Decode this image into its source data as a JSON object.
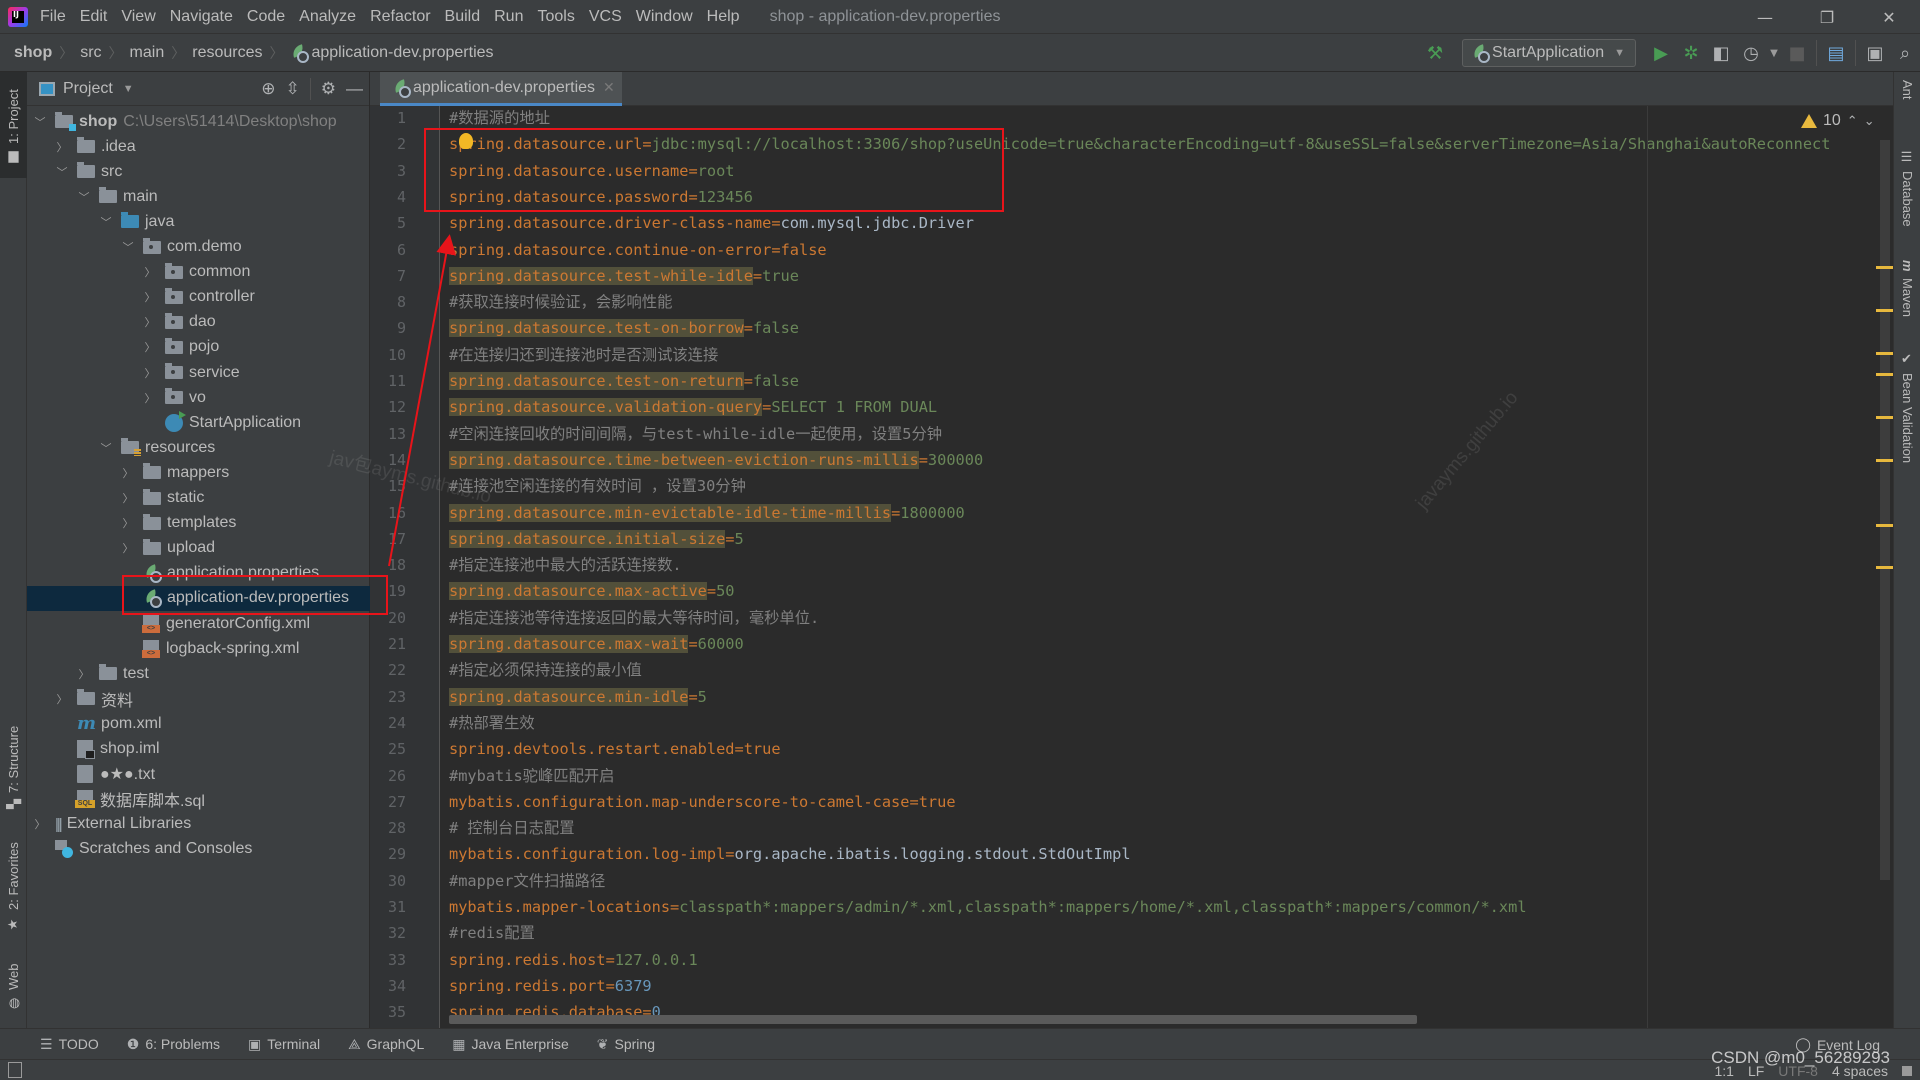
{
  "menubar": {
    "items": [
      "File",
      "Edit",
      "View",
      "Navigate",
      "Code",
      "Analyze",
      "Refactor",
      "Build",
      "Run",
      "Tools",
      "VCS",
      "Window",
      "Help"
    ],
    "window_title": "shop - application-dev.properties",
    "minimize": "—",
    "restore": "❐",
    "close": "✕"
  },
  "breadcrumb": [
    "shop",
    "src",
    "main",
    "resources",
    "application-dev.properties"
  ],
  "toolbar": {
    "run_config": "StartApplication"
  },
  "left_stripe": {
    "project": "1: Project",
    "structure": "7: Structure",
    "favorites": "2: Favorites",
    "web": "Web"
  },
  "right_stripe": [
    "Ant",
    "Database",
    "Maven",
    "Bean Validation"
  ],
  "project_panel": {
    "title": "Project",
    "tree": [
      {
        "label": "shop",
        "extra": "C:\\Users\\51414\\Desktop\\shop",
        "depth": 0,
        "arrow": "open",
        "icon": "module-folder"
      },
      {
        "label": ".idea",
        "depth": 1,
        "arrow": "closed",
        "icon": "folder"
      },
      {
        "label": "src",
        "depth": 1,
        "arrow": "open",
        "icon": "folder"
      },
      {
        "label": "main",
        "depth": 2,
        "arrow": "open",
        "icon": "folder"
      },
      {
        "label": "java",
        "depth": 3,
        "arrow": "open",
        "icon": "source-folder"
      },
      {
        "label": "com.demo",
        "depth": 4,
        "arrow": "open",
        "icon": "package"
      },
      {
        "label": "common",
        "depth": 5,
        "arrow": "closed",
        "icon": "package"
      },
      {
        "label": "controller",
        "depth": 5,
        "arrow": "closed",
        "icon": "package"
      },
      {
        "label": "dao",
        "depth": 5,
        "arrow": "closed",
        "icon": "package"
      },
      {
        "label": "pojo",
        "depth": 5,
        "arrow": "closed",
        "icon": "package"
      },
      {
        "label": "service",
        "depth": 5,
        "arrow": "closed",
        "icon": "package"
      },
      {
        "label": "vo",
        "depth": 5,
        "arrow": "closed",
        "icon": "package"
      },
      {
        "label": "StartApplication",
        "depth": 5,
        "arrow": "none",
        "icon": "spring-class"
      },
      {
        "label": "resources",
        "depth": 3,
        "arrow": "open",
        "icon": "resources-folder"
      },
      {
        "label": "mappers",
        "depth": 4,
        "arrow": "closed",
        "icon": "folder"
      },
      {
        "label": "static",
        "depth": 4,
        "arrow": "closed",
        "icon": "folder"
      },
      {
        "label": "templates",
        "depth": 4,
        "arrow": "closed",
        "icon": "folder"
      },
      {
        "label": "upload",
        "depth": 4,
        "arrow": "closed",
        "icon": "folder"
      },
      {
        "label": "application.properties",
        "depth": 4,
        "arrow": "none",
        "icon": "spring-properties"
      },
      {
        "label": "application-dev.properties",
        "depth": 4,
        "arrow": "none",
        "icon": "spring-properties",
        "selected": true
      },
      {
        "label": "generatorConfig.xml",
        "depth": 4,
        "arrow": "none",
        "icon": "xml"
      },
      {
        "label": "logback-spring.xml",
        "depth": 4,
        "arrow": "none",
        "icon": "xml"
      },
      {
        "label": "test",
        "depth": 2,
        "arrow": "closed",
        "icon": "folder"
      },
      {
        "label": "资料",
        "depth": 1,
        "arrow": "closed",
        "icon": "folder"
      },
      {
        "label": "pom.xml",
        "depth": 1,
        "arrow": "none",
        "icon": "maven"
      },
      {
        "label": "shop.iml",
        "depth": 1,
        "arrow": "none",
        "icon": "iml"
      },
      {
        "label": "●★●.txt",
        "depth": 1,
        "arrow": "none",
        "icon": "txt"
      },
      {
        "label": "数据库脚本.sql",
        "depth": 1,
        "arrow": "none",
        "icon": "sql"
      },
      {
        "label": "External Libraries",
        "depth": 0,
        "arrow": "closed",
        "icon": "libraries"
      },
      {
        "label": "Scratches and Consoles",
        "depth": 0,
        "arrow": "none",
        "icon": "scratches"
      }
    ]
  },
  "editor": {
    "tab_label": "application-dev.properties",
    "warnings_count": "10",
    "lines": [
      {
        "type": "comment",
        "text": "#数据源的地址"
      },
      {
        "type": "prop",
        "key": "spring.datasource.url",
        "value": "jdbc:mysql://localhost:3306/shop?useUnicode=true&characterEncoding=utf-8&useSSL=false&serverTimezone=Asia/Shanghai&autoReconnect",
        "vclass": "v"
      },
      {
        "type": "prop",
        "key": "spring.datasource.username",
        "value": "root",
        "vclass": "v"
      },
      {
        "type": "prop",
        "key": "spring.datasource.password",
        "value": "123456",
        "vclass": "v"
      },
      {
        "type": "prop",
        "key": "spring.datasource.driver-class-name",
        "value": "com.mysql.jdbc.Driver",
        "vclass": "vc"
      },
      {
        "type": "prop",
        "key": "spring.datasource.continue-on-error",
        "value": "false",
        "vclass": "vt"
      },
      {
        "type": "prop",
        "key": "spring.datasource.test-while-idle",
        "value": "true",
        "vclass": "v",
        "highlight": true
      },
      {
        "type": "comment",
        "text": "#获取连接时候验证，会影响性能"
      },
      {
        "type": "prop",
        "key": "spring.datasource.test-on-borrow",
        "value": "false",
        "vclass": "v",
        "highlight": true
      },
      {
        "type": "comment",
        "text": "#在连接归还到连接池时是否测试该连接"
      },
      {
        "type": "prop",
        "key": "spring.datasource.test-on-return",
        "value": "false",
        "vclass": "v",
        "highlight": true
      },
      {
        "type": "prop",
        "key": "spring.datasource.validation-query",
        "value": "SELECT 1 FROM DUAL",
        "vclass": "v",
        "highlight": true
      },
      {
        "type": "comment",
        "text": "#空闲连接回收的时间间隔，与test-while-idle一起使用，设置5分钟"
      },
      {
        "type": "prop",
        "key": "spring.datasource.time-between-eviction-runs-millis",
        "value": "300000",
        "vclass": "v",
        "highlight": true
      },
      {
        "type": "comment",
        "text": "#连接池空闲连接的有效时间 ，设置30分钟"
      },
      {
        "type": "prop",
        "key": "spring.datasource.min-evictable-idle-time-millis",
        "value": "1800000",
        "vclass": "v",
        "highlight": true
      },
      {
        "type": "prop",
        "key": "spring.datasource.initial-size",
        "value": "5",
        "vclass": "v",
        "highlight": true
      },
      {
        "type": "comment",
        "text": "#指定连接池中最大的活跃连接数."
      },
      {
        "type": "prop",
        "key": "spring.datasource.max-active",
        "value": "50",
        "vclass": "v",
        "highlight": true
      },
      {
        "type": "comment",
        "text": "#指定连接池等待连接返回的最大等待时间，毫秒单位."
      },
      {
        "type": "prop",
        "key": "spring.datasource.max-wait",
        "value": "60000",
        "vclass": "v",
        "highlight": true
      },
      {
        "type": "comment",
        "text": "#指定必须保持连接的最小值"
      },
      {
        "type": "prop",
        "key": "spring.datasource.min-idle",
        "value": "5",
        "vclass": "v",
        "highlight": true
      },
      {
        "type": "comment",
        "text": "#热部署生效"
      },
      {
        "type": "prop",
        "key": "spring.devtools.restart.enabled",
        "value": "true",
        "vclass": "vt"
      },
      {
        "type": "comment",
        "text": "#mybatis驼峰匹配开启"
      },
      {
        "type": "prop",
        "key": "mybatis.configuration.map-underscore-to-camel-case",
        "value": "true",
        "vclass": "vt"
      },
      {
        "type": "comment",
        "text": "# 控制台日志配置"
      },
      {
        "type": "prop",
        "key": "mybatis.configuration.log-impl",
        "value": "org.apache.ibatis.logging.stdout.StdOutImpl",
        "vclass": "vc"
      },
      {
        "type": "comment",
        "text": "#mapper文件扫描路径"
      },
      {
        "type": "prop",
        "key": "mybatis.mapper-locations",
        "value": "classpath*:mappers/admin/*.xml,classpath*:mappers/home/*.xml,classpath*:mappers/common/*.xml",
        "vclass": "v"
      },
      {
        "type": "comment",
        "text": "#redis配置"
      },
      {
        "type": "prop",
        "key": "spring.redis.host",
        "value": "127.0.0.1",
        "vclass": "v"
      },
      {
        "type": "prop",
        "key": "spring.redis.port",
        "value": "6379",
        "vclass": "vn"
      },
      {
        "type": "prop",
        "key": "spring.redis.database",
        "value": "0",
        "vclass": "vn"
      }
    ]
  },
  "watermarks": [
    "jav包ayms.github.io",
    "javayms.github.io"
  ],
  "bottom_tools": [
    "TODO",
    "6: Problems",
    "Terminal",
    "GraphQL",
    "Java Enterprise",
    "Spring"
  ],
  "event_log": "Event Log",
  "status": {
    "position": "1:1",
    "line_sep": "LF",
    "encoding": "UTF-8",
    "indent": "4 spaces"
  },
  "csdn_mark": "CSDN @m0_56289293",
  "colors": {
    "annotation_red": "#e8141a",
    "key_orange": "#cc7832",
    "value_green": "#6a8759",
    "comment_gray": "#808080",
    "selection_blue": "#0d293e"
  }
}
